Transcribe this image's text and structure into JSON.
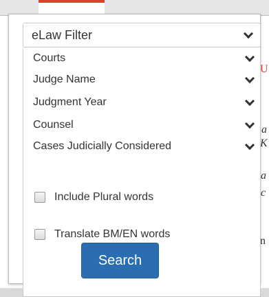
{
  "filter": {
    "title": "eLaw Filter",
    "options": [
      "Courts",
      "Judge Name",
      "Judgment Year",
      "Counsel",
      "Cases Judicially Considered"
    ],
    "checkboxes": [
      {
        "label": "Include Plural words",
        "checked": false
      },
      {
        "label": "Translate BM/EN words",
        "checked": false
      }
    ],
    "search_label": "Search"
  },
  "background": {
    "peek_1": "U",
    "peek_2": "a",
    "peek_3": "K",
    "peek_4": "a",
    "peek_5": "c",
    "peek_6": "n"
  },
  "colors": {
    "accent": "#d9412b",
    "button": "#2a6db0"
  }
}
